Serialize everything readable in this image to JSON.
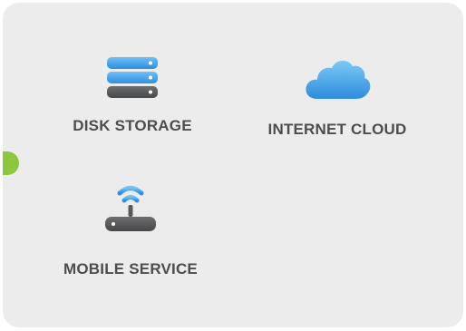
{
  "tiles": [
    {
      "label": "DISK STORAGE",
      "icon": "server-storage-icon"
    },
    {
      "label": "INTERNET CLOUD",
      "icon": "cloud-icon"
    },
    {
      "label": "MOBILE SERVICE",
      "icon": "wifi-router-icon"
    }
  ],
  "colors": {
    "panel_background": "#ececec",
    "label_text": "#4d4d4d",
    "accent_indicator": "#8dc63f",
    "icon_blue": "#3d9ee8",
    "icon_dark": "#58595b"
  }
}
